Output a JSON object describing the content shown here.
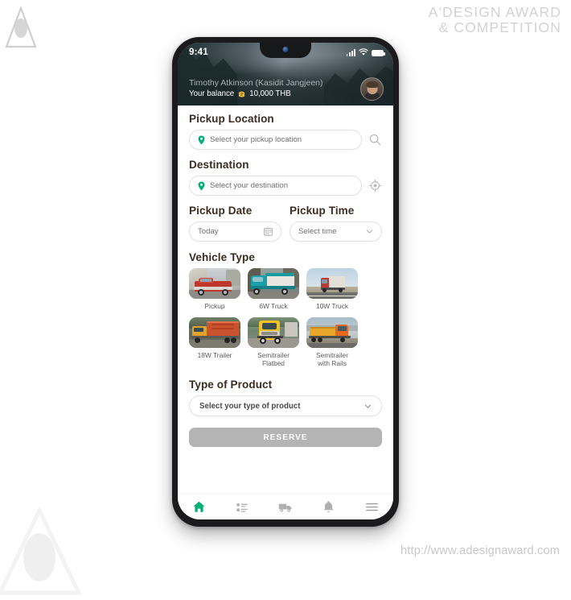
{
  "watermark": {
    "title_line1": "A'DESIGN AWARD",
    "title_line2": "& COMPETITION",
    "url": "http://www.adesignaward.com",
    "logo_icon": "a-triangle-logo-icon"
  },
  "phone": {
    "statusbar": {
      "time": "9:41",
      "signal_icon": "cellular-signal-icon",
      "wifi_icon": "wifi-icon",
      "battery_icon": "battery-full-icon"
    },
    "header": {
      "user_name": "Timothy Atkinson (Kasidit Jangjeen)",
      "balance_label": "Your balance",
      "balance_value": "10,000 THB",
      "coin_icon": "coin-stack-icon",
      "avatar_icon": "user-avatar"
    },
    "form": {
      "pickup_location": {
        "label": "Pickup Location",
        "placeholder": "Select your pickup location",
        "pin_icon": "map-pin-icon",
        "action_icon": "search-icon"
      },
      "destination": {
        "label": "Destination",
        "placeholder": "Select your destination",
        "pin_icon": "map-pin-icon",
        "action_icon": "current-location-icon"
      },
      "pickup_date": {
        "label": "Pickup Date",
        "value": "Today",
        "icon": "calendar-icon"
      },
      "pickup_time": {
        "label": "Pickup Time",
        "value": "Select time",
        "icon": "chevron-down-icon"
      },
      "vehicle_type": {
        "label": "Vehicle Type",
        "options": [
          {
            "label": "Pickup",
            "image": "red-pickup-truck-photo"
          },
          {
            "label": "6W Truck",
            "image": "teal-six-wheel-truck-photo"
          },
          {
            "label": "10W Truck",
            "image": "red-ten-wheel-truck-highway-photo"
          },
          {
            "label": "18W Trailer",
            "image": "orange-container-trailer-photo"
          },
          {
            "label": "Semitrailer\nFlatbed",
            "line1": "Semitrailer",
            "line2": "Flatbed",
            "image": "yellow-semitrailer-flatbed-photo"
          },
          {
            "label": "Semitrailer\nwith Rails",
            "line1": "Semitrailer",
            "line2": "with Rails",
            "image": "yellow-semitrailer-with-rails-photo"
          }
        ]
      },
      "type_of_product": {
        "label": "Type of Product",
        "value": "Select your type of product",
        "icon": "chevron-down-icon"
      },
      "reserve_button": "RESERVE"
    },
    "bottom_nav": [
      {
        "name": "home",
        "icon": "home-icon",
        "active": true
      },
      {
        "name": "orders",
        "icon": "list-icon",
        "active": false
      },
      {
        "name": "shipments",
        "icon": "truck-icon",
        "active": false
      },
      {
        "name": "notifications",
        "icon": "bell-icon",
        "active": false
      },
      {
        "name": "menu",
        "icon": "hamburger-menu-icon",
        "active": false
      }
    ]
  },
  "colors": {
    "accent_green": "#00b074",
    "heading_brown": "#3a2c20",
    "disabled_gray": "#b4b4b4",
    "watermark_gray": "#d3d3d3"
  }
}
